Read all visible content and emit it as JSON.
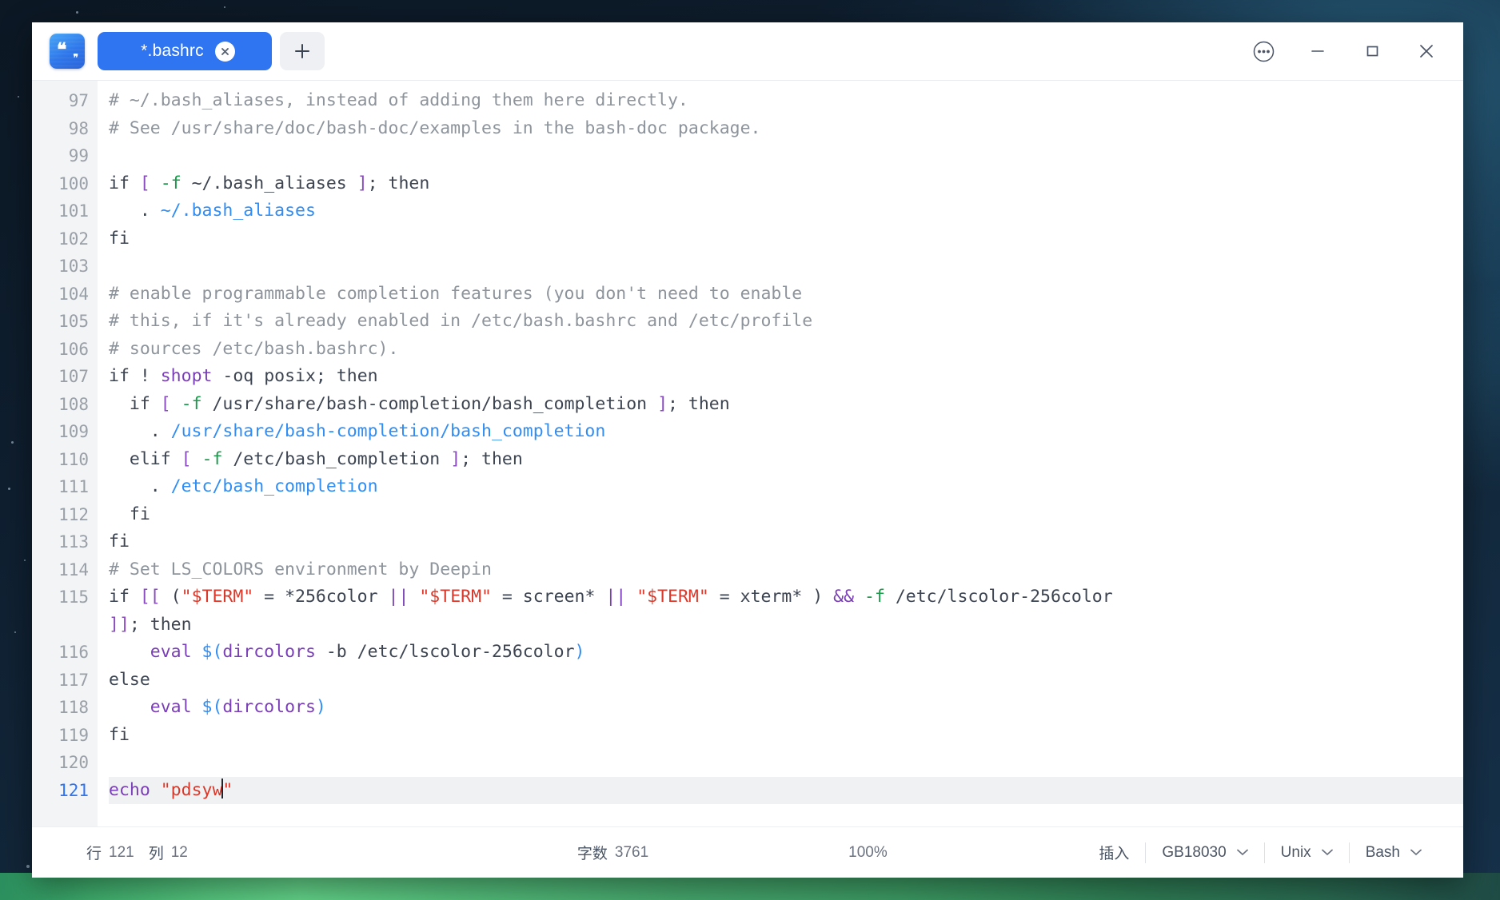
{
  "window": {
    "app_icon": "quotes-book-icon",
    "tabs": [
      {
        "title": "*.bashrc",
        "close_icon": "close-icon",
        "modified": true
      }
    ],
    "new_tab_icon": "plus-icon",
    "controls": {
      "menu_icon": "more-options-icon",
      "minimize_icon": "minimize-icon",
      "maximize_icon": "maximize-icon",
      "close_icon": "window-close-icon"
    }
  },
  "editor": {
    "first_line_number": 97,
    "current_line": 121,
    "lines": [
      {
        "n": "97",
        "tokens": [
          [
            "c-comment",
            "# ~/.bash_aliases, instead of adding them here directly."
          ]
        ]
      },
      {
        "n": "98",
        "tokens": [
          [
            "c-comment",
            "# See /usr/share/doc/bash-doc/examples in the bash-doc package."
          ]
        ]
      },
      {
        "n": "99",
        "tokens": [
          [
            "c-plain",
            ""
          ]
        ]
      },
      {
        "n": "100",
        "tokens": [
          [
            "c-kw",
            "if "
          ],
          [
            "c-brk",
            "["
          ],
          [
            "c-plain",
            " "
          ],
          [
            "c-flag",
            "-f"
          ],
          [
            "c-plain",
            " ~/.bash_aliases "
          ],
          [
            "c-brk",
            "]"
          ],
          [
            "c-plain",
            "; "
          ],
          [
            "c-kw",
            "then"
          ]
        ]
      },
      {
        "n": "101",
        "tokens": [
          [
            "c-plain",
            "   . "
          ],
          [
            "c-path",
            "~/.bash_aliases"
          ]
        ]
      },
      {
        "n": "102",
        "tokens": [
          [
            "c-kw",
            "fi"
          ]
        ]
      },
      {
        "n": "103",
        "tokens": [
          [
            "c-plain",
            ""
          ]
        ]
      },
      {
        "n": "104",
        "tokens": [
          [
            "c-comment",
            "# enable programmable completion features (you don't need to enable"
          ]
        ]
      },
      {
        "n": "105",
        "tokens": [
          [
            "c-comment",
            "# this, if it's already enabled in /etc/bash.bashrc and /etc/profile"
          ]
        ]
      },
      {
        "n": "106",
        "tokens": [
          [
            "c-comment",
            "# sources /etc/bash.bashrc)."
          ]
        ]
      },
      {
        "n": "107",
        "tokens": [
          [
            "c-kw",
            "if "
          ],
          [
            "c-plain",
            "! "
          ],
          [
            "c-builtin",
            "shopt"
          ],
          [
            "c-plain",
            " -oq posix; "
          ],
          [
            "c-kw",
            "then"
          ]
        ]
      },
      {
        "n": "108",
        "tokens": [
          [
            "c-plain",
            "  "
          ],
          [
            "c-kw",
            "if "
          ],
          [
            "c-brk",
            "["
          ],
          [
            "c-plain",
            " "
          ],
          [
            "c-flag",
            "-f"
          ],
          [
            "c-plain",
            " /usr/share/bash-completion/bash_completion "
          ],
          [
            "c-brk",
            "]"
          ],
          [
            "c-plain",
            "; "
          ],
          [
            "c-kw",
            "then"
          ]
        ]
      },
      {
        "n": "109",
        "tokens": [
          [
            "c-plain",
            "    . "
          ],
          [
            "c-path",
            "/usr/share/bash-completion/bash_completion"
          ]
        ]
      },
      {
        "n": "110",
        "tokens": [
          [
            "c-plain",
            "  "
          ],
          [
            "c-kw",
            "elif "
          ],
          [
            "c-brk",
            "["
          ],
          [
            "c-plain",
            " "
          ],
          [
            "c-flag",
            "-f"
          ],
          [
            "c-plain",
            " /etc/bash_completion "
          ],
          [
            "c-brk",
            "]"
          ],
          [
            "c-plain",
            "; "
          ],
          [
            "c-kw",
            "then"
          ]
        ]
      },
      {
        "n": "111",
        "tokens": [
          [
            "c-plain",
            "    . "
          ],
          [
            "c-path",
            "/etc/bash_completion"
          ]
        ]
      },
      {
        "n": "112",
        "tokens": [
          [
            "c-plain",
            "  "
          ],
          [
            "c-kw",
            "fi"
          ]
        ]
      },
      {
        "n": "113",
        "tokens": [
          [
            "c-kw",
            "fi"
          ]
        ]
      },
      {
        "n": "114",
        "tokens": [
          [
            "c-comment",
            "# Set LS_COLORS environment by Deepin"
          ]
        ]
      },
      {
        "n": "115",
        "tokens": [
          [
            "c-kw",
            "if "
          ],
          [
            "c-brk",
            "[["
          ],
          [
            "c-plain",
            " ("
          ],
          [
            "c-str",
            "\"$TERM\""
          ],
          [
            "c-plain",
            " = *256color "
          ],
          [
            "c-op",
            "||"
          ],
          [
            "c-plain",
            " "
          ],
          [
            "c-str",
            "\"$TERM\""
          ],
          [
            "c-plain",
            " = screen* "
          ],
          [
            "c-op",
            "||"
          ],
          [
            "c-plain",
            " "
          ],
          [
            "c-str",
            "\"$TERM\""
          ],
          [
            "c-plain",
            " = xterm* ) "
          ],
          [
            "c-op",
            "&&"
          ],
          [
            "c-plain",
            " "
          ],
          [
            "c-flag",
            "-f"
          ],
          [
            "c-plain",
            " /etc/lscolor-256color"
          ]
        ]
      },
      {
        "n": "",
        "tokens": [
          [
            "c-brk",
            "]]"
          ],
          [
            "c-plain",
            "; "
          ],
          [
            "c-kw",
            "then"
          ]
        ],
        "wrapped": true
      },
      {
        "n": "116",
        "tokens": [
          [
            "c-plain",
            "    "
          ],
          [
            "c-builtin",
            "eval"
          ],
          [
            "c-plain",
            " "
          ],
          [
            "c-dollar",
            "$("
          ],
          [
            "c-builtin",
            "dircolors"
          ],
          [
            "c-plain",
            " -b /etc/lscolor-256color"
          ],
          [
            "c-dollar",
            ")"
          ]
        ]
      },
      {
        "n": "117",
        "tokens": [
          [
            "c-kw",
            "else"
          ]
        ]
      },
      {
        "n": "118",
        "tokens": [
          [
            "c-plain",
            "    "
          ],
          [
            "c-builtin",
            "eval"
          ],
          [
            "c-plain",
            " "
          ],
          [
            "c-dollar",
            "$("
          ],
          [
            "c-builtin",
            "dircolors"
          ],
          [
            "c-dollar",
            ")"
          ]
        ]
      },
      {
        "n": "119",
        "tokens": [
          [
            "c-kw",
            "fi"
          ]
        ]
      },
      {
        "n": "120",
        "tokens": [
          [
            "c-plain",
            ""
          ]
        ]
      },
      {
        "n": "121",
        "tokens": [
          [
            "c-op",
            "echo"
          ],
          [
            "c-plain",
            " "
          ],
          [
            "c-str",
            "\"pdsyw"
          ],
          [
            "caret",
            ""
          ],
          [
            "c-str",
            "\""
          ]
        ],
        "active": true
      }
    ],
    "focus_highlight_color": "#e8390f"
  },
  "statusbar": {
    "line_label": "行",
    "line_value": "121",
    "col_label": "列",
    "col_value": "12",
    "wordcount_label": "字数",
    "wordcount_value": "3761",
    "zoom": "100%",
    "insert_mode": "插入",
    "encoding": "GB18030",
    "line_ending": "Unix",
    "language": "Bash",
    "chevron_icon": "chevron-down-icon"
  }
}
